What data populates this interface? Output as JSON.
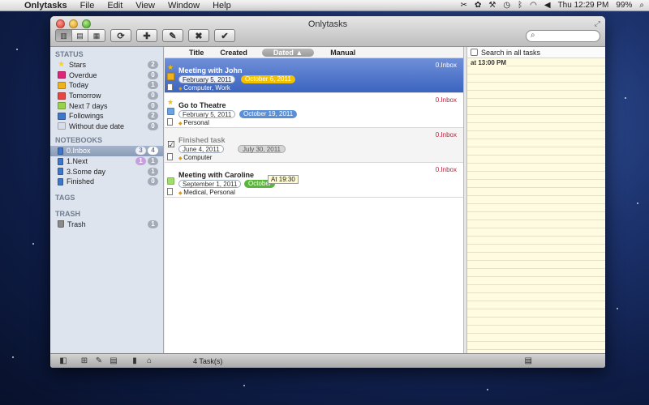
{
  "menubar": {
    "app": "Onlytasks",
    "menus": [
      "File",
      "Edit",
      "View",
      "Window",
      "Help"
    ],
    "clock": "Thu 12:29 PM",
    "battery": "99%"
  },
  "window": {
    "title": "Onlytasks",
    "search_placeholder": ""
  },
  "sidebar": {
    "status_header": "STATUS",
    "status": [
      {
        "label": "Stars",
        "count": "2",
        "color": "#f5d13a"
      },
      {
        "label": "Overdue",
        "count": "0",
        "color": "#e0247a"
      },
      {
        "label": "Today",
        "count": "1",
        "color": "#f0b21a"
      },
      {
        "label": "Tomorrow",
        "count": "0",
        "color": "#e94444"
      },
      {
        "label": "Next 7 days",
        "count": "0",
        "color": "#9ad14b"
      },
      {
        "label": "Followings",
        "count": "2",
        "color": "#3e76c8"
      },
      {
        "label": "Without due date",
        "count": "0",
        "color": "#d8dde8"
      }
    ],
    "notebooks_header": "NOTEBOOKS",
    "notebooks": [
      {
        "label": "0.Inbox",
        "count1": "3",
        "count2": "4"
      },
      {
        "label": "1.Next",
        "count1": "1",
        "count2": "1"
      },
      {
        "label": "3.Some day",
        "count2": "1"
      },
      {
        "label": "Finished",
        "count2": "0"
      }
    ],
    "tags_header": "TAGS",
    "trash_header": "TRASH",
    "trash": {
      "label": "Trash",
      "count": "1"
    }
  },
  "sortbar": [
    "Title",
    "Created",
    "Dated",
    "Manual"
  ],
  "tasks": [
    {
      "title": "Meeting with John",
      "created": "February 5, 2011",
      "dated": "October 6, 2011",
      "dated_color": "#f2c200",
      "tags": "Computer, Work",
      "notebook": "0.Inbox",
      "color": "#f0b21a"
    },
    {
      "title": "Go to Theatre",
      "created": "February 5, 2011",
      "dated": "October 19, 2011",
      "dated_color": "#5a8fd6",
      "tags": "Personal",
      "notebook": "0.Inbox",
      "color": "#6aa3e4"
    },
    {
      "title": "Finished task",
      "created": "June 4, 2011",
      "dated": "July 30, 2011",
      "dated_color": "#d6d6d6",
      "tags": "Computer",
      "notebook": "0.Inbox"
    },
    {
      "title": "Meeting with Caroline",
      "created": "September 1, 2011",
      "dated": "October",
      "dated_color": "#59b63a",
      "tags": "Medical, Personal",
      "notebook": "0.Inbox",
      "color": "#9ee06a",
      "tooltip": "At 19:30"
    }
  ],
  "right_pane": {
    "search_all_label": "Search in all tasks",
    "note_time": "at 13:00 PM"
  },
  "footer": {
    "task_count": "4 Task(s)"
  }
}
